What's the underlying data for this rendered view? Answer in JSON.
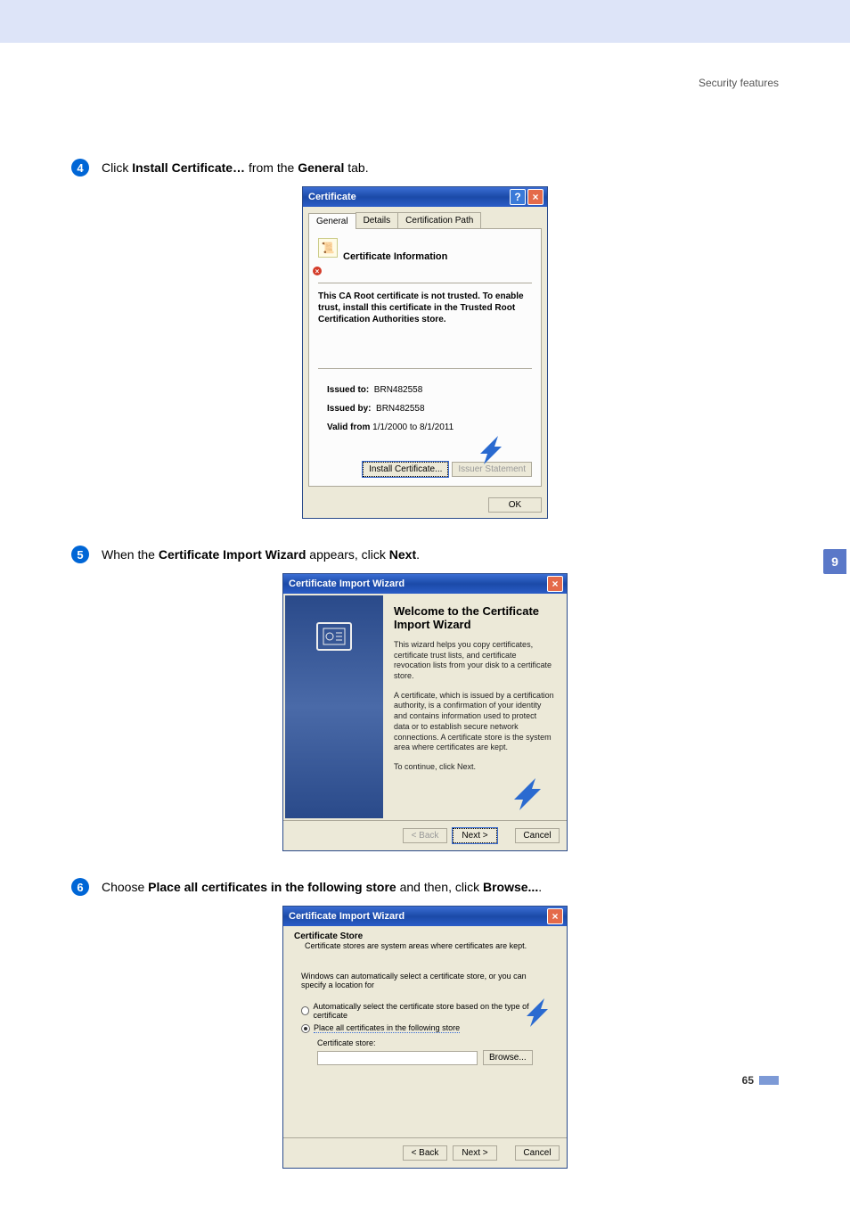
{
  "header": {
    "section_title": "Security features"
  },
  "steps": {
    "s4": {
      "num": "4",
      "t1": "Click ",
      "t2": "Install Certificate…",
      "t3": " from the ",
      "t4": "General",
      "t5": " tab."
    },
    "s5": {
      "num": "5",
      "t1": "When the ",
      "t2": "Certificate Import Wizard",
      "t3": " appears, click ",
      "t4": "Next",
      "t5": "."
    },
    "s6": {
      "num": "6",
      "t1": "Choose ",
      "t2": "Place all certificates in the following store",
      "t3": " and then, click ",
      "t4": "Browse...",
      "t5": "."
    }
  },
  "dialog1": {
    "title": "Certificate",
    "tabs": {
      "general": "General",
      "details": "Details",
      "path": "Certification Path"
    },
    "heading": "Certificate Information",
    "trust_msg": "This CA Root certificate is not trusted. To enable trust, install this certificate in the Trusted Root Certification Authorities store.",
    "issued_to_label": "Issued to:",
    "issued_to": "BRN482558",
    "issued_by_label": "Issued by:",
    "issued_by": "BRN482558",
    "valid_label": "Valid from",
    "valid_value": "1/1/2000 to 8/1/2011",
    "install_btn": "Install Certificate...",
    "issuer_btn": "Issuer Statement",
    "ok": "OK"
  },
  "dialog2": {
    "title": "Certificate Import Wizard",
    "welcome": "Welcome to the Certificate Import Wizard",
    "p1": "This wizard helps you copy certificates, certificate trust lists, and certificate revocation lists from your disk to a certificate store.",
    "p2": "A certificate, which is issued by a certification authority, is a confirmation of your identity and contains information used to protect data or to establish secure network connections. A certificate store is the system area where certificates are kept.",
    "p3": "To continue, click Next.",
    "back": "< Back",
    "next": "Next >",
    "cancel": "Cancel"
  },
  "dialog3": {
    "title": "Certificate Import Wizard",
    "header": "Certificate Store",
    "subheader": "Certificate stores are system areas where certificates are kept.",
    "intro": "Windows can automatically select a certificate store, or you can specify a location for",
    "opt1": "Automatically select the certificate store based on the type of certificate",
    "opt2": "Place all certificates in the following store",
    "store_label": "Certificate store:",
    "browse": "Browse...",
    "back": "< Back",
    "next": "Next >",
    "cancel": "Cancel"
  },
  "side_tab": "9",
  "page_number": "65"
}
